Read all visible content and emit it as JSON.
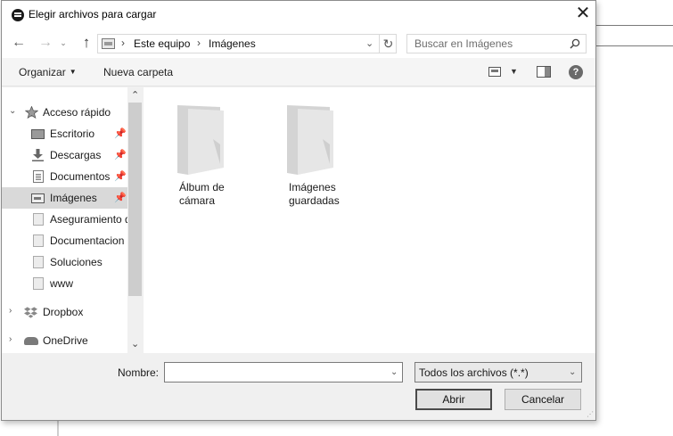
{
  "dialog": {
    "title": "Elegir archivos para cargar",
    "close_glyph": "✕"
  },
  "nav": {
    "back_glyph": "←",
    "forward_glyph": "→",
    "recent_glyph": "⌄",
    "up_glyph": "↑",
    "address": {
      "crumbs": [
        "Este equipo",
        "Imágenes"
      ],
      "separator": "›",
      "dropdown_glyph": "⌄",
      "refresh_glyph": "↻"
    },
    "search_placeholder": "Buscar en Imágenes"
  },
  "toolbar": {
    "organize_label": "Organizar",
    "organize_caret": "▼",
    "new_folder_label": "Nueva carpeta",
    "view_caret": "▼",
    "help_glyph": "?"
  },
  "sidebar": {
    "chevron_open": "⌄",
    "chevron_closed": "›",
    "pin_glyph": "📌",
    "items": [
      {
        "label": "Acceso rápido",
        "icon": "star-icon"
      },
      {
        "label": "Escritorio",
        "icon": "desktop-icon",
        "pinned": true
      },
      {
        "label": "Descargas",
        "icon": "download-icon",
        "pinned": true
      },
      {
        "label": "Documentos",
        "icon": "document-icon",
        "pinned": true
      },
      {
        "label": "Imágenes",
        "icon": "pictures-icon",
        "pinned": true,
        "selected": true
      },
      {
        "label": "Aseguramiento de",
        "icon": "folder-icon"
      },
      {
        "label": "Documentacion",
        "icon": "folder-icon"
      },
      {
        "label": "Soluciones",
        "icon": "folder-icon"
      },
      {
        "label": "www",
        "icon": "folder-icon"
      },
      {
        "label": "Dropbox",
        "icon": "dropbox-icon"
      },
      {
        "label": "OneDrive",
        "icon": "cloud-icon"
      }
    ],
    "scroll_up_glyph": "⌃",
    "scroll_down_glyph": "⌄"
  },
  "content": {
    "items": [
      {
        "label": "Álbum de\ncámara",
        "icon": "folder-icon"
      },
      {
        "label": "Imágenes\nguardadas",
        "icon": "folder-icon"
      }
    ]
  },
  "footer": {
    "name_label": "Nombre:",
    "name_value": "",
    "dropdown_glyph": "⌄",
    "filter_value": "Todos los archivos (*.*)",
    "open_label": "Abrir",
    "cancel_label": "Cancelar",
    "grip_glyph": "⋰"
  },
  "colors": {
    "selected_bg": "#d9d9d9",
    "dialog_bg": "#f0f0f0",
    "folder_fill": "#e2e2e2"
  }
}
